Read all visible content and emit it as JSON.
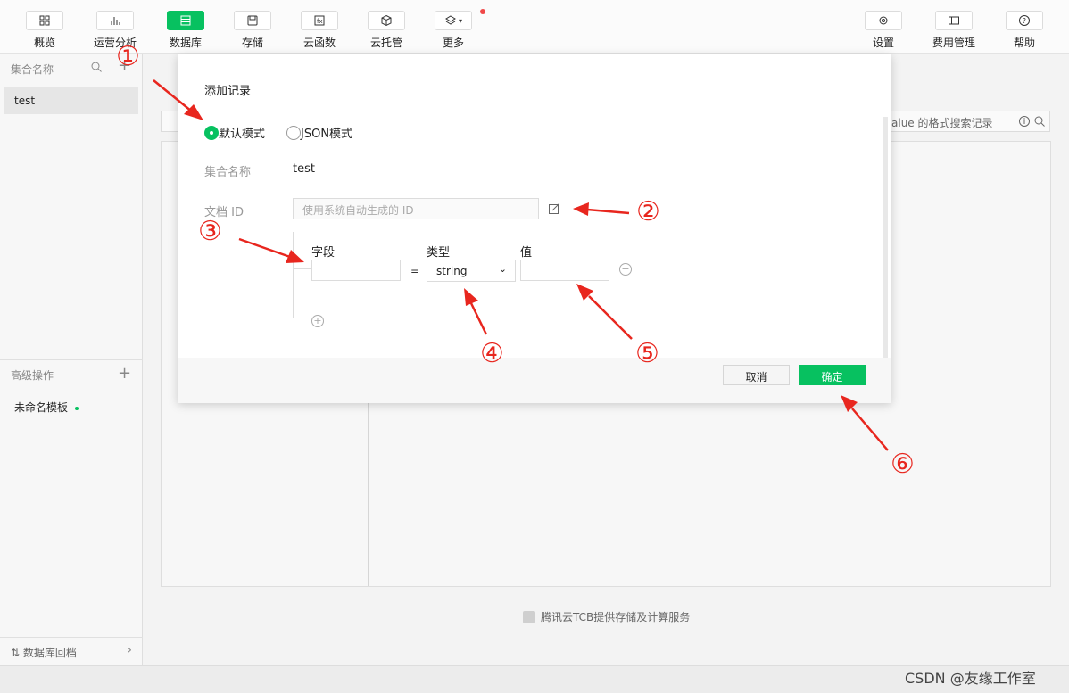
{
  "toolbar": {
    "left": [
      {
        "label": "概览",
        "icon": "grid-icon"
      },
      {
        "label": "运营分析",
        "icon": "chart-icon"
      },
      {
        "label": "数据库",
        "icon": "database-icon"
      },
      {
        "label": "存储",
        "icon": "storage-icon"
      },
      {
        "label": "云函数",
        "icon": "function-icon"
      },
      {
        "label": "云托管",
        "icon": "cube-icon"
      },
      {
        "label": "更多",
        "icon": "layers-icon"
      }
    ],
    "right": [
      {
        "label": "设置",
        "icon": "gear-icon"
      },
      {
        "label": "费用管理",
        "icon": "billing-icon"
      },
      {
        "label": "帮助",
        "icon": "help-icon"
      }
    ]
  },
  "sidebar": {
    "header": "集合名称",
    "collection": "test",
    "advanced_header": "高级操作",
    "template_item": "未命名模板",
    "bottom_item": "数据库回档"
  },
  "main": {
    "search_placeholder": "alue 的格式搜索记录",
    "footer": "腾讯云TCB提供存储及计算服务"
  },
  "dialog": {
    "title": "添加记录",
    "mode_default": "默认模式",
    "mode_json": "JSON模式",
    "collection_label": "集合名称",
    "collection_value": "test",
    "docid_label": "文档 ID",
    "docid_placeholder": "使用系统自动生成的 ID",
    "col_field": "字段",
    "col_type": "类型",
    "col_value": "值",
    "equals": "=",
    "type_selected": "string",
    "cancel": "取消",
    "ok": "确定"
  },
  "annotations": [
    "①",
    "②",
    "③",
    "④",
    "⑤",
    "⑥"
  ],
  "watermark": "CSDN @友缘工作室",
  "colors": {
    "accent": "#07c160",
    "annotation": "#e8261e"
  }
}
